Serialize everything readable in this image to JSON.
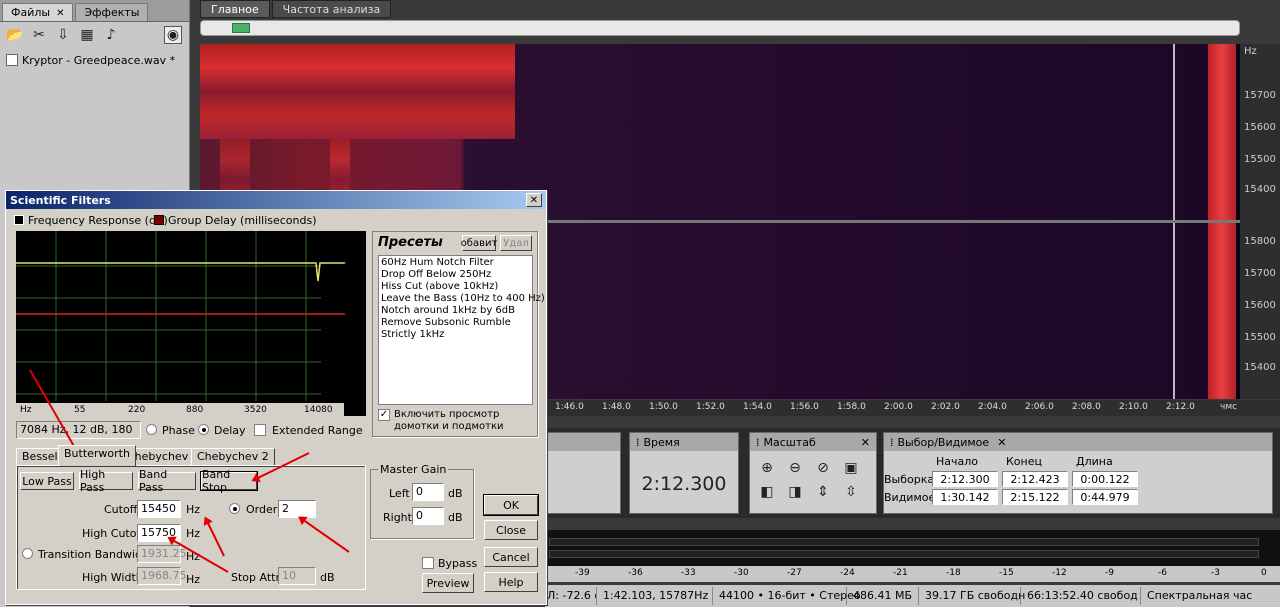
{
  "left_panel": {
    "tabs": [
      {
        "label": "Файлы"
      },
      {
        "label": "Эффекты"
      }
    ],
    "file": "Kryptor - Greedpeace.wav *"
  },
  "main": {
    "tabs": [
      {
        "label": "Главное"
      },
      {
        "label": "Частота анализа"
      }
    ],
    "hz_unit": "Hz",
    "hz_labels_top": [
      "15700",
      "15600",
      "15500",
      "15400"
    ],
    "hz_labels_bottom": [
      "15800",
      "15700",
      "15600",
      "15500",
      "15400"
    ],
    "time_labels": [
      "1:46.0",
      "1:48.0",
      "1:50.0",
      "1:52.0",
      "1:54.0",
      "1:56.0",
      "1:58.0",
      "2:00.0",
      "2:02.0",
      "2:04.0",
      "2:06.0",
      "2:08.0",
      "2:10.0",
      "2:12.0"
    ],
    "time_unit": "чмс"
  },
  "time_panel": {
    "title": "Время",
    "value": "2:12.300"
  },
  "zoom_panel": {
    "title": "Масштаб"
  },
  "selection_panel": {
    "title": "Выбор/Видимое",
    "col_start": "Начало",
    "col_end": "Конец",
    "col_len": "Длина",
    "row_sel": "Выборка",
    "row_vis": "Видимое",
    "sel_start": "2:12.300",
    "sel_end": "2:12.423",
    "sel_len": "0:00.122",
    "vis_start": "1:30.142",
    "vis_end": "2:15.122",
    "vis_len": "0:44.979"
  },
  "meter_scale": [
    "-39",
    "-36",
    "-33",
    "-30",
    "-27",
    "-24",
    "-21",
    "-18",
    "-15",
    "-12",
    "-9",
    "-6",
    "-3",
    "0"
  ],
  "status": {
    "level": "Л: -72.6 dB @",
    "pos": "1:42.103, 15787Hz",
    "format": "44100 • 16-бит • Стерео",
    "size": "486.41 МБ",
    "free": "39.17 ГБ свободн",
    "time_free": "66:13:52.40 свобод",
    "view": "Спектральная час"
  },
  "dialog": {
    "title": "Scientific Filters",
    "legend_freq": "Frequency Response (dB)",
    "legend_delay": "Group Delay (milliseconds)",
    "db_unit": "dB",
    "db_ticks": [
      "0",
      "-6",
      "-12",
      "-18",
      "-24",
      "-30",
      "-36",
      "-42",
      "-48"
    ],
    "hz_ticks": [
      "Hz",
      "55",
      "220",
      "880",
      "3520",
      "14080"
    ],
    "info_line": "7084 Hz, 12 dB, 180",
    "phase_label": "Phase",
    "delay_label": "Delay",
    "extended_label": "Extended Range",
    "presets_title": "Пресеты",
    "add_label": "обавит",
    "del_label": "Удал",
    "presets": [
      "60Hz Hum Notch Filter",
      "Drop Off Below 250Hz",
      "Hiss Cut (above 10kHz)",
      "Leave the Bass (10Hz to 400 Hz)",
      "Notch around 1kHz by 6dB",
      "Remove Subsonic Rumble",
      "Strictly 1kHz"
    ],
    "preview_chk_line1": "Включить просмотр",
    "preview_chk_line2": "домотки и подмотки",
    "filter_tabs": [
      "Bessel",
      "Butterworth",
      "Chebychev 1",
      "Chebychev 2"
    ],
    "type_buttons": [
      "Low Pass",
      "High Pass",
      "Band Pass",
      "Band Stop"
    ],
    "cutoff_label": "Cutoff",
    "cutoff_value": "15450",
    "high_cutoff_label": "High Cutoff",
    "high_cutoff_value": "15750",
    "trans_label": "Transition Bandwidth",
    "trans_value": "1931.25",
    "high_width_label": "High Width",
    "high_width_value": "1968.75",
    "hz": "Hz",
    "order_label": "Order",
    "order_value": "2",
    "stop_attn_label": "Stop Attn",
    "stop_attn_value": "10",
    "master_gain_title": "Master Gain",
    "left_label": "Left",
    "left_value": "0",
    "right_label": "Right",
    "right_value": "0",
    "bypass_label": "Bypass",
    "preview_label": "Preview",
    "ok_label": "OK",
    "close_label": "Close",
    "cancel_label": "Cancel",
    "help_label": "Help"
  }
}
